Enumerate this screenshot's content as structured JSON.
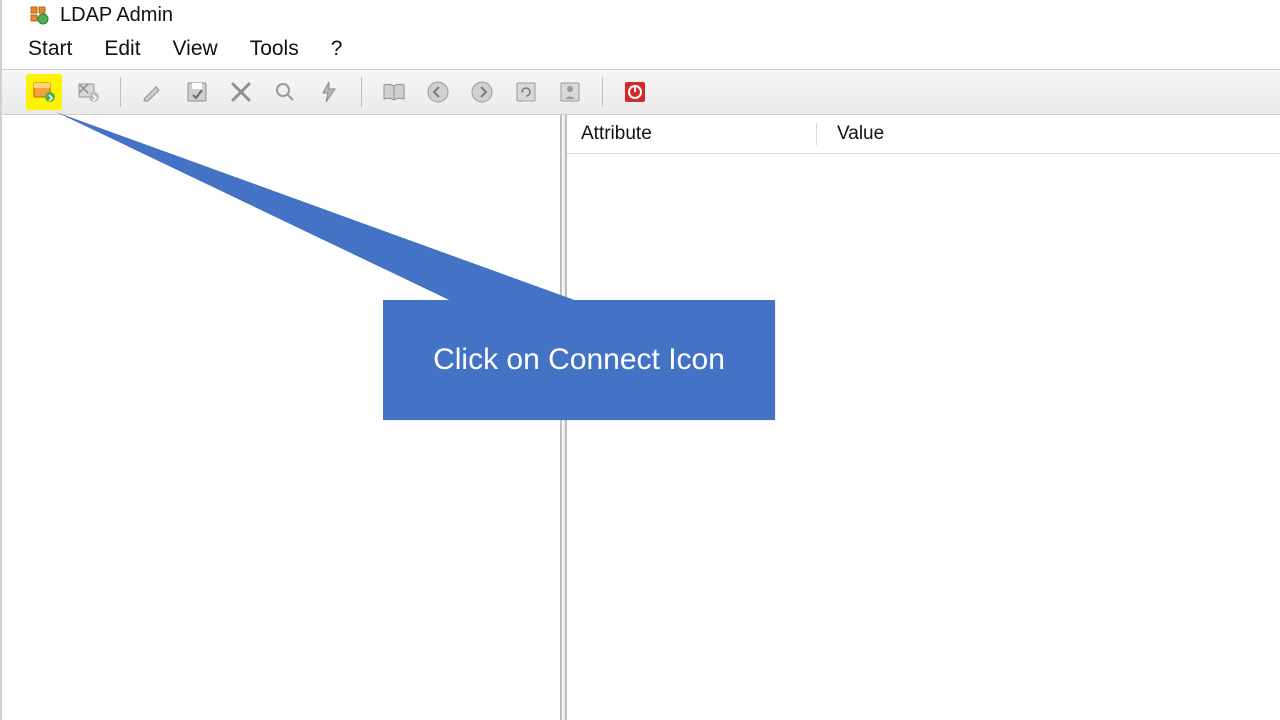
{
  "title": "LDAP Admin",
  "menu": {
    "start": "Start",
    "edit": "Edit",
    "view": "View",
    "tools": "Tools",
    "help": "?"
  },
  "toolbar": {
    "connect": "connect-icon",
    "disconnect": "disconnect-icon",
    "edit": "edit-icon",
    "save": "save-icon",
    "delete": "delete-icon",
    "search": "search-icon",
    "execute": "execute-icon",
    "book": "book-icon",
    "back": "back-icon",
    "forward": "forward-icon",
    "refresh": "refresh-icon",
    "schema": "schema-icon",
    "power": "power-icon"
  },
  "grid": {
    "attribute_header": "Attribute",
    "value_header": "Value"
  },
  "callout": {
    "text": "Click on Connect Icon",
    "color": "#4472C4"
  }
}
